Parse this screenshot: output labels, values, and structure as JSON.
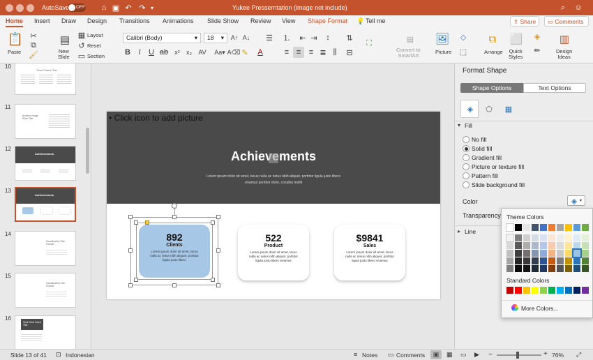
{
  "titlebar": {
    "autosave_label": "AutoSave",
    "autosave_state": "OFF",
    "doc_title": "Yukee Presserntation (image not include)"
  },
  "tabs": [
    "Home",
    "Insert",
    "Draw",
    "Design",
    "Transitions",
    "Animations",
    "Slide Show",
    "Review",
    "View",
    "Shape Format",
    "Tell me"
  ],
  "share": {
    "share_label": "Share",
    "comments_label": "Comments"
  },
  "ribbon": {
    "paste": "Paste",
    "new_slide": "New\nSlide",
    "layout": "Layout",
    "reset": "Reset",
    "section": "Section",
    "font_name": "Calibri (Body)",
    "font_size": "18",
    "convert_smartart": "Convert to\nSmartArt",
    "picture": "Picture",
    "arrange": "Arrange",
    "quick_styles": "Quick\nStyles",
    "design_ideas": "Design\nIdeas"
  },
  "thumbnails": [
    {
      "num": "10",
      "title": "Three Column Text"
    },
    {
      "num": "11",
      "title": "Another Image Slide Title"
    },
    {
      "num": "12",
      "title": "Achievements"
    },
    {
      "num": "13",
      "title": "Achievements"
    },
    {
      "num": "14",
      "title": "Visualization Title Format"
    },
    {
      "num": "15",
      "title": "Visualization Title Format"
    },
    {
      "num": "16",
      "title": "Click Here Insert Title"
    }
  ],
  "slide": {
    "placeholder": "• Click icon to add picture",
    "title": "Achievements",
    "subtitle_1": "Lorem ipsum dolor sit amet, lacus nulla ac netus nibh aliquet, porttitor ligula justo libero",
    "subtitle_2": "vivamus porttitor dolor, conubia mollit",
    "cards": [
      {
        "value": "892",
        "label": "Clients",
        "text": "Lorem ipsum dolor sit amet, lacus nulla ac netus nibh aliquet, porttitor ligula justo libero"
      },
      {
        "value": "522",
        "label": "Product",
        "text": "Lorem ipsum dolor sit amet, lacus nulla ac netus nibh aliquet, porttitor ligula justo libero vivamus"
      },
      {
        "value": "$9841",
        "label": "Sales",
        "text": "Lorem ipsum dolor sit amet, lacus nulla ac netus nibh aliquet, porttitor ligula justo libero vivamus"
      }
    ]
  },
  "format_pane": {
    "title": "Format Shape",
    "tab_shape": "Shape Options",
    "tab_text": "Text Options",
    "fill_header": "Fill",
    "fill_options": [
      "No fill",
      "Solid fill",
      "Gradient fill",
      "Picture or texture fill",
      "Pattern fill",
      "Slide background fill"
    ],
    "selected_fill": "Solid fill",
    "color_label": "Color",
    "transparency_label": "Transparency",
    "line_header": "Line"
  },
  "color_popup": {
    "theme_header": "Theme Colors",
    "standard_header": "Standard Colors",
    "more_colors": "More Colors...",
    "theme_top": [
      "#ffffff",
      "#000000",
      "#e7e6e6",
      "#44546a",
      "#4472c4",
      "#ed7d31",
      "#a5a5a5",
      "#ffc000",
      "#5b9bd5",
      "#70ad47"
    ],
    "theme_shades": [
      [
        "#f2f2f2",
        "#7f7f7f",
        "#d0cece",
        "#d6dce4",
        "#d9e2f3",
        "#fbe5d5",
        "#ededed",
        "#fff2cc",
        "#deebf6",
        "#e2efd9"
      ],
      [
        "#d8d8d8",
        "#595959",
        "#aeabab",
        "#adb9ca",
        "#b4c6e7",
        "#f7cbac",
        "#dbdbdb",
        "#fee599",
        "#bdd7ee",
        "#c5e0b3"
      ],
      [
        "#bfbfbf",
        "#3f3f3f",
        "#757070",
        "#8496b0",
        "#8eaadb",
        "#f4b183",
        "#c9c9c9",
        "#ffd965",
        "#9cc3e5",
        "#a8d08d"
      ],
      [
        "#a5a5a5",
        "#262626",
        "#3a3838",
        "#323f4f",
        "#2f5496",
        "#c55a11",
        "#7b7b7b",
        "#bf9000",
        "#2e75b5",
        "#538135"
      ],
      [
        "#7f7f7f",
        "#0c0c0c",
        "#171616",
        "#222a35",
        "#1f3864",
        "#833c0b",
        "#525252",
        "#7f6000",
        "#1e4e79",
        "#375623"
      ]
    ],
    "standard": [
      "#c00000",
      "#ff0000",
      "#ffc000",
      "#ffff00",
      "#92d050",
      "#00b050",
      "#00b0f0",
      "#0070c0",
      "#002060",
      "#7030a0"
    ]
  },
  "statusbar": {
    "slide_info": "Slide 13 of 41",
    "language": "Indonesian",
    "notes": "Notes",
    "comments": "Comments",
    "zoom": "76%"
  },
  "colors": {
    "accent": "#c4532d",
    "selected_shape": "#a7c7e7",
    "slide_header_bg": "#4a4a4a"
  }
}
